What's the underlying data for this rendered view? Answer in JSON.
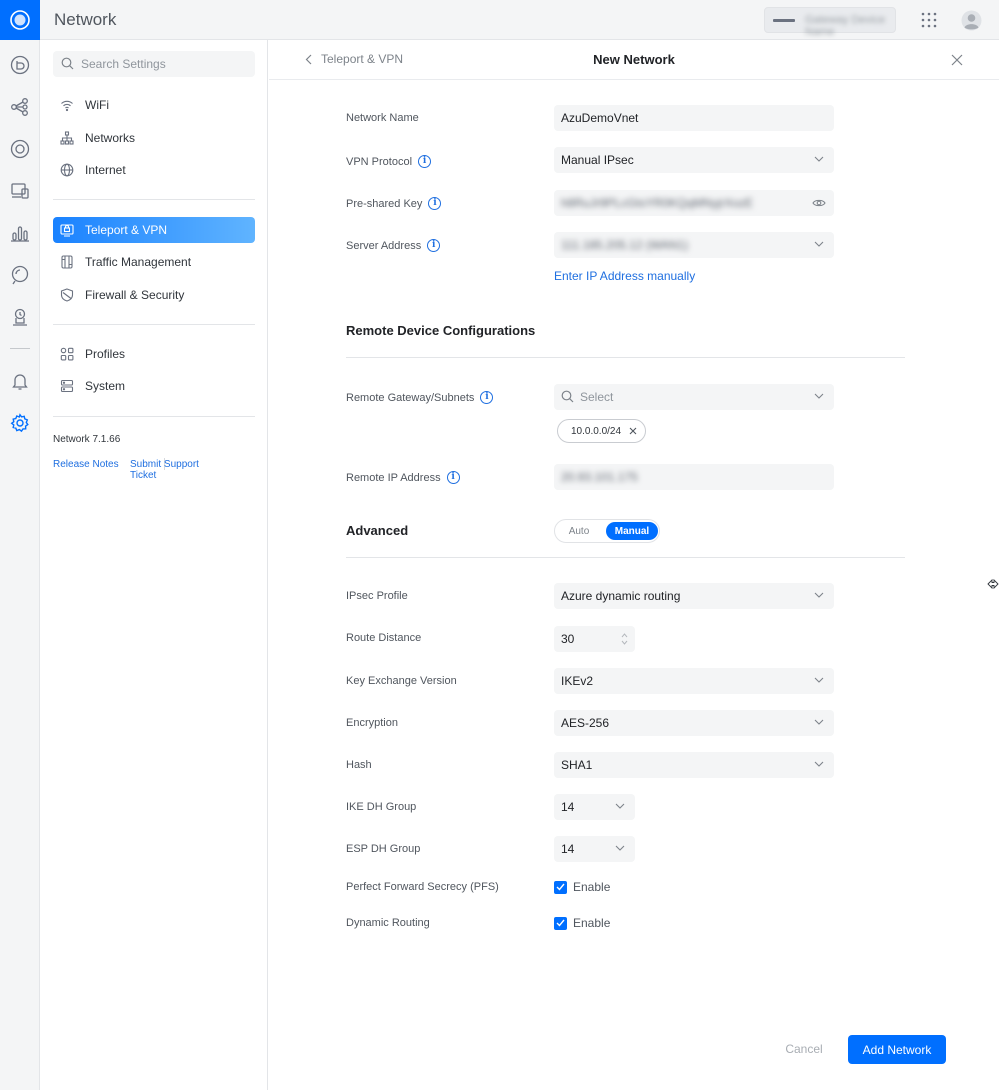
{
  "app": {
    "title": "Network",
    "device_name": "Gateway Device Name",
    "logo_icon": "ubiquiti-logo-icon",
    "accent_color": "#006fff"
  },
  "rail": {
    "icons": [
      "dashboard-icon",
      "topology-icon",
      "devices-icon",
      "clients-icon",
      "statistics-icon",
      "insights-icon",
      "system-log-icon",
      "alarms-icon",
      "settings-icon"
    ]
  },
  "sidebar": {
    "search_placeholder": "Search Settings",
    "groups": [
      {
        "items": [
          {
            "label": "WiFi",
            "icon": "wifi-icon"
          },
          {
            "label": "Networks",
            "icon": "networks-icon"
          },
          {
            "label": "Internet",
            "icon": "globe-icon"
          }
        ]
      },
      {
        "items": [
          {
            "label": "Teleport & VPN",
            "icon": "vpn-icon",
            "active": true
          },
          {
            "label": "Traffic Management",
            "icon": "traffic-icon"
          },
          {
            "label": "Firewall & Security",
            "icon": "shield-icon"
          }
        ]
      },
      {
        "items": [
          {
            "label": "Profiles",
            "icon": "profiles-icon"
          },
          {
            "label": "System",
            "icon": "system-icon"
          }
        ]
      }
    ],
    "version": "Network 7.1.66",
    "release_notes": "Release Notes",
    "support_ticket": "Submit Support Ticket"
  },
  "panel": {
    "back_label": "Teleport & VPN",
    "title": "New Network"
  },
  "form": {
    "network_name": {
      "label": "Network Name",
      "value": "AzuDemoVnet"
    },
    "vpn_protocol": {
      "label": "VPN Protocol",
      "value": "Manual IPsec"
    },
    "pre_shared_key": {
      "label": "Pre-shared Key",
      "value": "h8RuJr9PLcGtsYR0KQqMNyjrXozE"
    },
    "server_address": {
      "label": "Server Address",
      "value": "111.185.205.12 (WAN1)"
    },
    "enter_ip_manually": "Enter IP Address manually",
    "remote_section_title": "Remote Device Configurations",
    "remote_gateway": {
      "label": "Remote Gateway/Subnets",
      "placeholder": "Select",
      "chips": [
        "10.0.0.0/24"
      ]
    },
    "remote_ip": {
      "label": "Remote IP Address",
      "value": "20.93.101.175"
    },
    "advanced": {
      "title": "Advanced",
      "options": [
        "Auto",
        "Manual"
      ],
      "selected": "Manual"
    },
    "ipsec_profile": {
      "label": "IPsec Profile",
      "value": "Azure dynamic routing"
    },
    "route_distance": {
      "label": "Route Distance",
      "value": "30"
    },
    "key_exchange": {
      "label": "Key Exchange Version",
      "value": "IKEv2"
    },
    "encryption": {
      "label": "Encryption",
      "value": "AES-256"
    },
    "hash": {
      "label": "Hash",
      "value": "SHA1"
    },
    "ike_dh": {
      "label": "IKE DH Group",
      "value": "14"
    },
    "esp_dh": {
      "label": "ESP DH Group",
      "value": "14"
    },
    "pfs": {
      "label": "Perfect Forward Secrecy (PFS)",
      "checkbox_label": "Enable",
      "checked": true
    },
    "dynamic_routing": {
      "label": "Dynamic Routing",
      "checkbox_label": "Enable",
      "checked": true
    }
  },
  "footer": {
    "cancel_label": "Cancel",
    "submit_label": "Add Network"
  }
}
